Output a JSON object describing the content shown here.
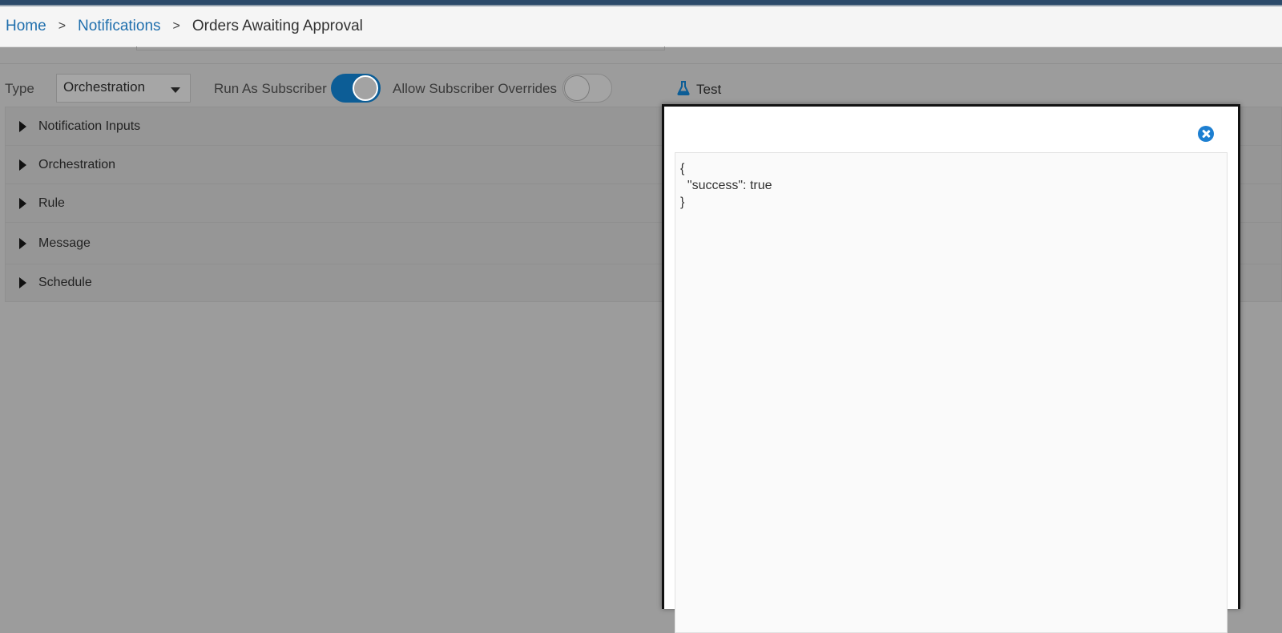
{
  "breadcrumb": {
    "home": "Home",
    "separator": ">",
    "notifications": "Notifications",
    "current": "Orders Awaiting Approval"
  },
  "toolbar": {
    "type_label": "Type",
    "type_value": "Orchestration",
    "run_as_subscriber_label": "Run As Subscriber",
    "run_as_subscriber_on": true,
    "allow_overrides_label": "Allow Subscriber Overrides",
    "allow_overrides_on": false,
    "test_label": "Test"
  },
  "sections": [
    {
      "label": "Notification Inputs"
    },
    {
      "label": "Orchestration"
    },
    {
      "label": "Rule"
    },
    {
      "label": "Message"
    },
    {
      "label": "Schedule"
    }
  ],
  "modal": {
    "json_lines": [
      "{",
      "  \"success\": true",
      "}"
    ]
  },
  "colors": {
    "accent": "#0c5d96",
    "link": "#1f6fad",
    "close_icon": "#1d7fd1"
  }
}
